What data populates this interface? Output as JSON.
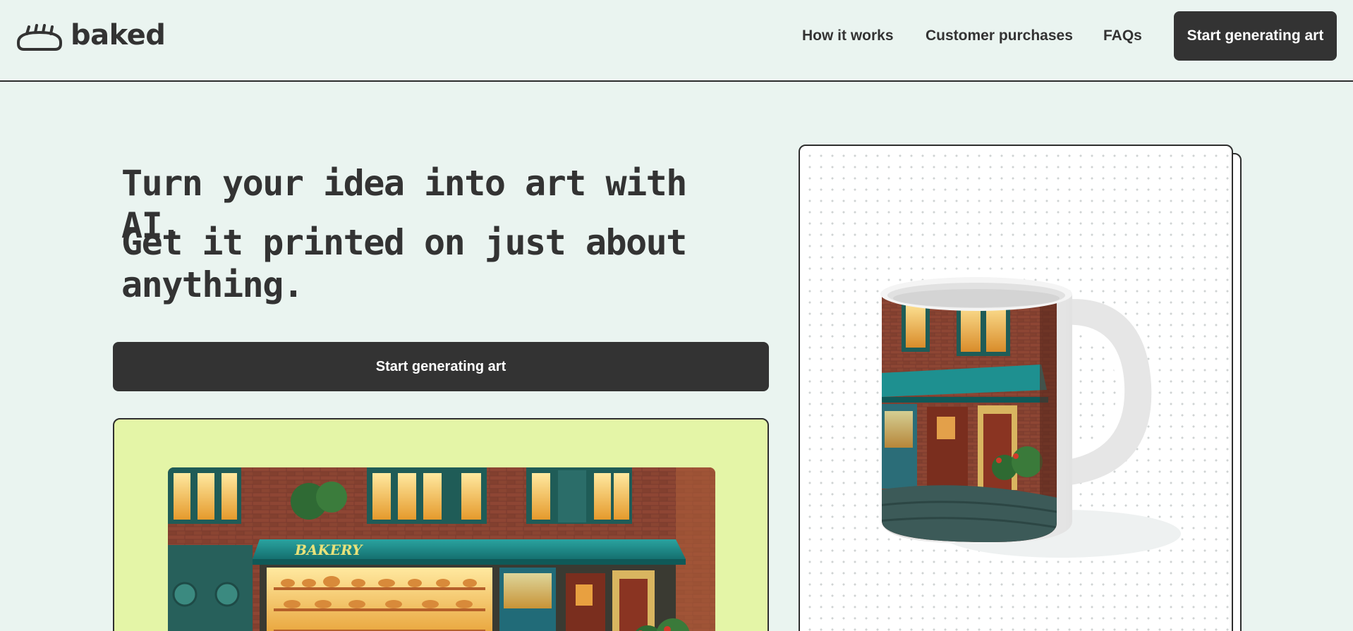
{
  "brand": {
    "name": "baked",
    "icon": "bread-icon"
  },
  "nav": {
    "links": [
      {
        "label": "How it works"
      },
      {
        "label": "Customer purchases"
      },
      {
        "label": "FAQs"
      }
    ],
    "cta_label": "Start generating art"
  },
  "hero": {
    "headline": "Turn your idea into art with AI.",
    "subheadline": "Get it printed on just about anything.",
    "cta_label": "Start generating art"
  },
  "showcase": {
    "image": "bakery-storefront-artwork",
    "sign_text": "BAKERY"
  },
  "product_card": {
    "image": "mug-with-bakery-print"
  },
  "colors": {
    "background": "#eaf4f0",
    "primary_dark": "#333333",
    "showcase_bg": "#e4f5a7",
    "awning_teal": "#1e8b8b"
  }
}
